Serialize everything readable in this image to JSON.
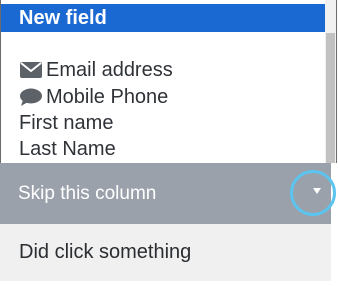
{
  "dropdown": {
    "options": [
      {
        "label": "New field",
        "selected": true
      },
      {
        "label": "Email address",
        "icon": "envelope-icon"
      },
      {
        "label": "Mobile Phone",
        "icon": "chat-bubble-icon"
      },
      {
        "label": "First name"
      },
      {
        "label": "Last Name"
      }
    ]
  },
  "select": {
    "current_value": "Skip this column",
    "arrow_icon": "caret-down-icon"
  },
  "status": {
    "text": "Did click something"
  },
  "colors": {
    "selected_bg": "#1a68d1",
    "select_bg": "#9aa1ab",
    "highlight_ring": "#5bc4ef",
    "status_bg": "#f0f0f0"
  }
}
